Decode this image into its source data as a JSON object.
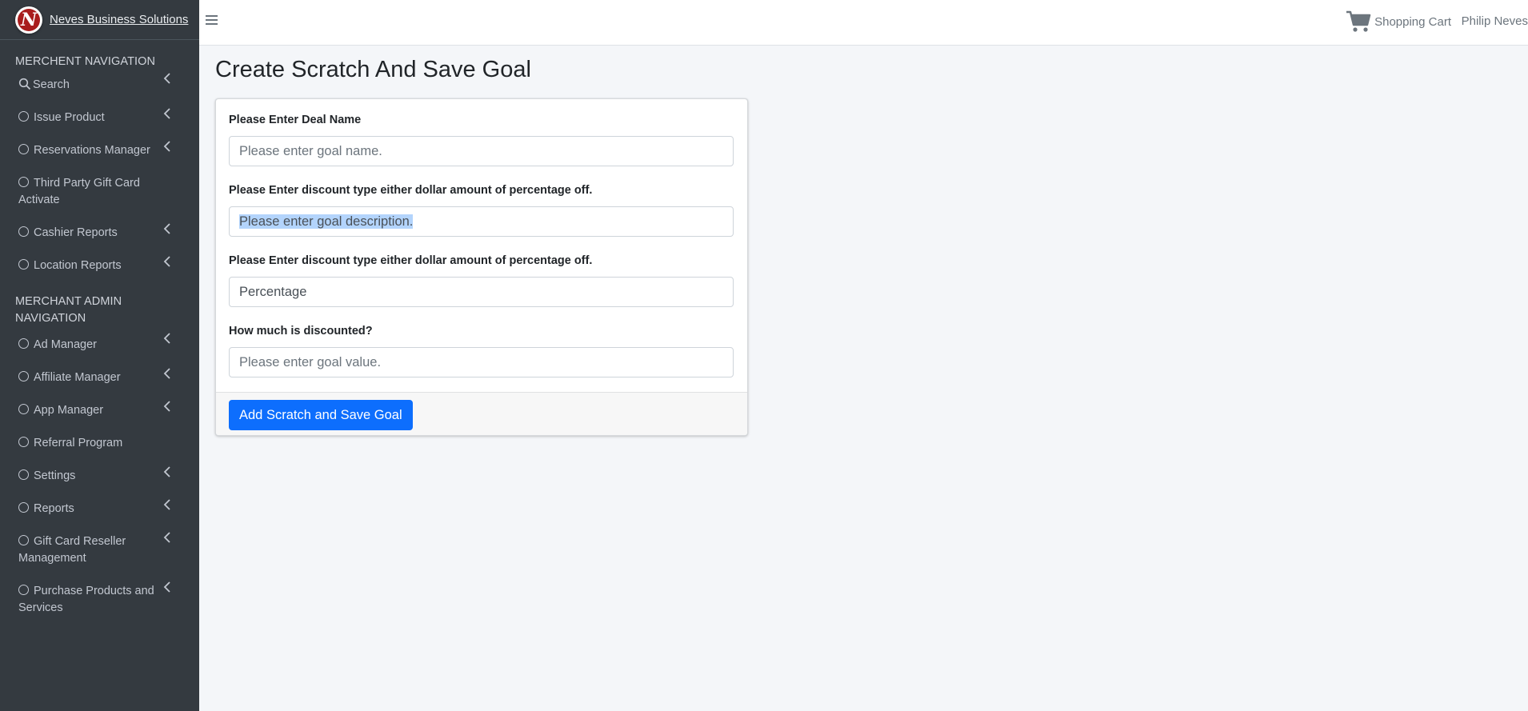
{
  "brand": {
    "name": "Neves Business Solutions",
    "logo_letter": "N"
  },
  "sidebar": {
    "sections": [
      {
        "header": "MERCHENT NAVIGATION",
        "items": [
          {
            "label": "Search",
            "icon": "search-icon",
            "has_chevron": true
          },
          {
            "label": "Issue Product",
            "icon": "circle-icon",
            "has_chevron": true
          },
          {
            "label": "Reservations Manager",
            "icon": "circle-icon",
            "has_chevron": true
          },
          {
            "label": "Third Party Gift Card Activate",
            "icon": "circle-icon",
            "has_chevron": false
          },
          {
            "label": "Cashier Reports",
            "icon": "circle-icon",
            "has_chevron": true
          },
          {
            "label": "Location Reports",
            "icon": "circle-icon",
            "has_chevron": true
          }
        ]
      },
      {
        "header": "MERCHANT ADMIN NAVIGATION",
        "items": [
          {
            "label": "Ad Manager",
            "icon": "circle-icon",
            "has_chevron": true
          },
          {
            "label": "Affiliate Manager",
            "icon": "circle-icon",
            "has_chevron": true
          },
          {
            "label": "App Manager",
            "icon": "circle-icon",
            "has_chevron": true
          },
          {
            "label": "Referral Program",
            "icon": "circle-icon",
            "has_chevron": false
          },
          {
            "label": "Settings",
            "icon": "circle-icon",
            "has_chevron": true
          },
          {
            "label": "Reports",
            "icon": "circle-icon",
            "has_chevron": true
          },
          {
            "label": "Gift Card Reseller Management",
            "icon": "circle-icon",
            "has_chevron": true
          },
          {
            "label": "Purchase Products and Services",
            "icon": "circle-icon",
            "has_chevron": true
          }
        ]
      }
    ]
  },
  "topbar": {
    "cart_label": "Shopping Cart",
    "user_name": "Philip Neves"
  },
  "page": {
    "title": "Create Scratch And Save Goal"
  },
  "form": {
    "fields": [
      {
        "label": "Please Enter Deal Name",
        "value": "",
        "placeholder": "Please enter goal name.",
        "selected": false
      },
      {
        "label": "Please Enter discount type either dollar amount of percentage off.",
        "value": "",
        "placeholder": "Please enter goal description.",
        "selected": true
      },
      {
        "label": "Please Enter discount type either dollar amount of percentage off.",
        "value": "Percentage",
        "placeholder": "",
        "selected": false
      },
      {
        "label": "How much is discounted?",
        "value": "",
        "placeholder": "Please enter goal value.",
        "selected": false
      }
    ],
    "submit_label": "Add Scratch and Save Goal"
  },
  "colors": {
    "sidebar_bg": "#343a40",
    "primary": "#0d6efd",
    "content_bg": "#f4f6f9",
    "logo_red": "#a91d1d"
  }
}
